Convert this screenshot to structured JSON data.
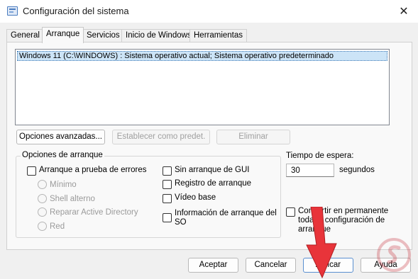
{
  "window": {
    "title": "Configuración del sistema",
    "close_glyph": "✕"
  },
  "tabs": [
    {
      "label": "General",
      "active": false
    },
    {
      "label": "Arranque",
      "active": true
    },
    {
      "label": "Servicios",
      "active": false
    },
    {
      "label": "Inicio de Windows",
      "active": false
    },
    {
      "label": "Herramientas",
      "active": false
    }
  ],
  "os_list": {
    "entries": [
      "Windows 11 (C:\\WINDOWS) : Sistema operativo actual; Sistema operativo predeterminado"
    ]
  },
  "list_buttons": {
    "advanced": "Opciones avanzadas...",
    "set_default": "Establecer como predet.",
    "delete": "Eliminar"
  },
  "boot_options": {
    "group_label": "Opciones de arranque",
    "safe_boot": "Arranque a prueba de errores",
    "minimal": "Mínimo",
    "alternate_shell": "Shell alterno",
    "repair_ad": "Reparar Active Directory",
    "network": "Red",
    "no_gui_boot": "Sin arranque de GUI",
    "boot_log": "Registro de arranque",
    "base_video": "Vídeo base",
    "os_boot_info_line1": "Información de arranque del",
    "os_boot_info_line2": "SO"
  },
  "timeout": {
    "label": "Tiempo de espera:",
    "value": "30",
    "unit": "segundos"
  },
  "permanent": {
    "line1": "Convertir en permanente",
    "line2": "toda la configuración de",
    "line3": "arranque"
  },
  "dialog_buttons": {
    "ok": "Aceptar",
    "cancel": "Cancelar",
    "apply": "Aplicar",
    "help": "Ayuda"
  },
  "colors": {
    "selection": "#cce4f7",
    "arrow": "#e8343a"
  },
  "icons": {
    "app": "system-config-icon",
    "annotation": "red-pointer-arrow",
    "watermark": "brand-watermark-logo"
  }
}
